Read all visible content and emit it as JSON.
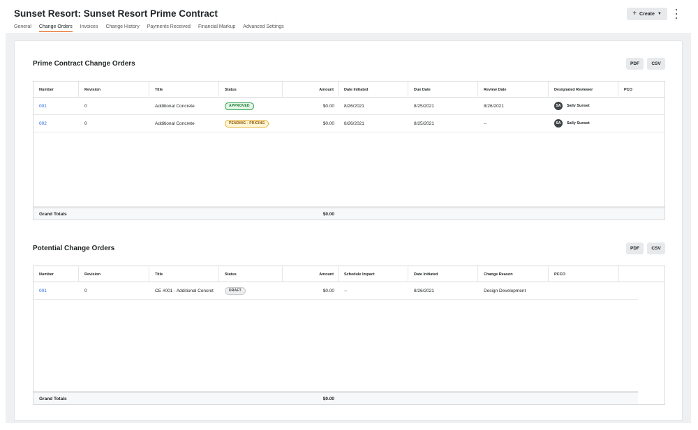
{
  "header": {
    "title": "Sunset Resort: Sunset Resort Prime Contract",
    "tabs": [
      {
        "label": "General"
      },
      {
        "label": "Change Orders",
        "active": true
      },
      {
        "label": "Invoices"
      },
      {
        "label": "Change History"
      },
      {
        "label": "Payments Received"
      },
      {
        "label": "Financial Markup"
      },
      {
        "label": "Advanced Settings"
      }
    ],
    "create_label": "Create",
    "create_icon": "plus-icon",
    "more_icon": "kebab-menu-icon"
  },
  "prime": {
    "title": "Prime Contract Change Orders",
    "pdf_label": "PDF",
    "csv_label": "CSV",
    "columns": [
      "Number",
      "Revision",
      "Title",
      "Status",
      "Amount",
      "Date Initiated",
      "Due Date",
      "Review Date",
      "Designated Reviewer",
      "PCO"
    ],
    "rows": [
      {
        "number": "001",
        "revision": "0",
        "title": "Additional Concrete",
        "status": "APPROVED",
        "amount": "$0.00",
        "date_initiated": "8/26/2021",
        "due_date": "8/25/2021",
        "review_date": "8/26/2021",
        "reviewer_initials": "SA",
        "reviewer": "Sally Sunset",
        "pco": ""
      },
      {
        "number": "002",
        "revision": "0",
        "title": "Additional Concrete",
        "status": "PENDING - PRICING",
        "amount": "$0.00",
        "date_initiated": "8/26/2021",
        "due_date": "8/25/2021",
        "review_date": "--",
        "reviewer_initials": "SA",
        "reviewer": "Sally Sunset",
        "pco": ""
      }
    ],
    "totals_label": "Grand Totals",
    "totals_amount": "$0.00"
  },
  "potential": {
    "title": "Potential Change Orders",
    "pdf_label": "PDF",
    "csv_label": "CSV",
    "columns": [
      "Number",
      "Revision",
      "Title",
      "Status",
      "Amount",
      "Schedule Impact",
      "Date Initiated",
      "Change Reason",
      "PCCO"
    ],
    "rows": [
      {
        "number": "001",
        "revision": "0",
        "title": "CE #001 - Additional Concret",
        "status": "DRAFT",
        "amount": "$0.00",
        "schedule_impact": "--",
        "date_initiated": "8/26/2021",
        "change_reason": "Design Development",
        "pcco": ""
      }
    ],
    "totals_label": "Grand Totals",
    "totals_amount": "$0.00"
  },
  "colors": {
    "accent_tab": "#e36c1d",
    "link": "#2066df",
    "approved": "#2ea44f",
    "pending": "#e6b84a"
  }
}
